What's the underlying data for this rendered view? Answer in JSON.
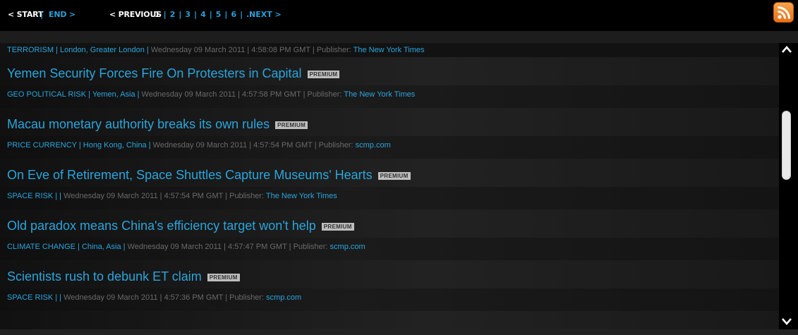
{
  "pager": {
    "start": "< START",
    "sep": "|",
    "end": "END >",
    "previous": "< PREVIOUS",
    "current": "1",
    "pages": [
      "2",
      "3",
      "4",
      "5",
      "6",
      "..."
    ],
    "next": "NEXT >"
  },
  "rss_icon": "rss-feed-icon",
  "first_item": {
    "category": "TERRORISM | London, Greater London |",
    "date": " Wednesday 09 March 2011 | 4:58:08 PM GMT | Publisher: ",
    "publisher": "The New York Times"
  },
  "items": [
    {
      "title": "Yemen Security Forces Fire On Protesters in Capital",
      "badge": "PREMIUM",
      "category": "GEO POLITICAL RISK | Yemen, Asia |",
      "date": " Wednesday 09 March 2011 | 4:57:58 PM GMT | Publisher: ",
      "publisher": "The New York Times"
    },
    {
      "title": "Macau monetary authority breaks its own rules",
      "badge": "PREMIUM",
      "category": "PRICE CURRENCY | Hong Kong, China |",
      "date": " Wednesday 09 March 2011 | 4:57:54 PM GMT | Publisher: ",
      "publisher": "scmp.com"
    },
    {
      "title": "On Eve of Retirement, Space Shuttles Capture Museums' Hearts",
      "badge": "PREMIUM",
      "category": "SPACE RISK |  |",
      "date": " Wednesday 09 March 2011 | 4:57:54 PM GMT | Publisher: ",
      "publisher": "The New York Times"
    },
    {
      "title": "Old paradox means China's efficiency target won't help",
      "badge": "PREMIUM",
      "category": "CLIMATE CHANGE | China, Asia |",
      "date": " Wednesday 09 March 2011 | 4:57:47 PM GMT | Publisher: ",
      "publisher": "scmp.com"
    },
    {
      "title": "Scientists rush to debunk ET claim",
      "badge": "PREMIUM",
      "category": "SPACE RISK |  |",
      "date": " Wednesday 09 March 2011 | 4:57:36 PM GMT | Publisher: ",
      "publisher": "scmp.com"
    }
  ],
  "colors": {
    "link": "#2aa5dc",
    "dim": "#6a6a6a",
    "rss": "#e7701b"
  }
}
